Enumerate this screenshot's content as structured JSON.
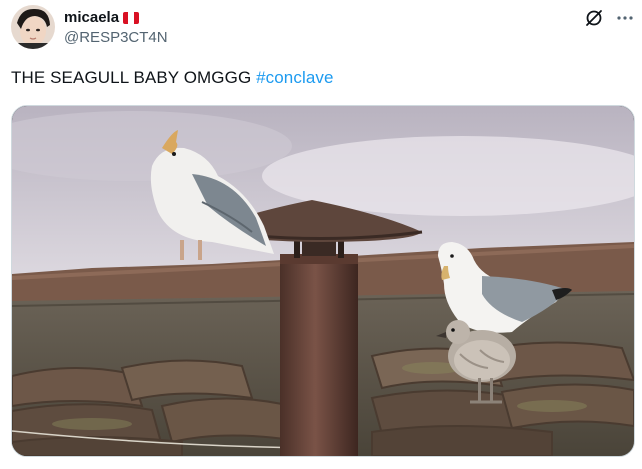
{
  "author": {
    "display_name": "micaela",
    "flag": "peru-flag",
    "handle": "@RESP3CT4N"
  },
  "tweet": {
    "text": "THE SEAGULL BABY OMGGG ",
    "hashtag": "#conclave"
  },
  "icons": {
    "grok": "grok-icon",
    "more": "more-icon"
  },
  "colors": {
    "hashtag": "#1d9bf0",
    "handle": "#536471",
    "flag_red": "#d91023"
  }
}
